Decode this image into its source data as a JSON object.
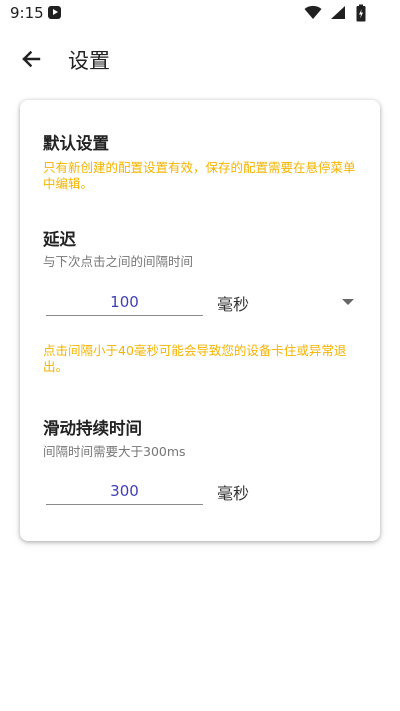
{
  "status_bar": {
    "time": "9:15",
    "icons": [
      "play-store-icon",
      "wifi-icon",
      "signal-icon",
      "battery-icon"
    ]
  },
  "app_bar": {
    "back_icon": "arrow-left-icon",
    "title": "设置"
  },
  "card": {
    "default_settings": {
      "title": "默认设置",
      "notice": "只有新创建的配置设置有效，保存的配置需要在悬停菜单中编辑。"
    },
    "delay": {
      "title": "延迟",
      "hint": "与下次点击之间的间隔时间",
      "value": "100",
      "unit": "毫秒",
      "warning": "点击间隔小于40毫秒可能会导致您的设备卡住或异常退出。"
    },
    "swipe_duration": {
      "title": "滑动持续时间",
      "hint": "间隔时间需要大于300ms",
      "value": "300",
      "unit": "毫秒"
    }
  },
  "colors": {
    "warning": "#F5B400",
    "input_text": "#3F3FB5"
  }
}
